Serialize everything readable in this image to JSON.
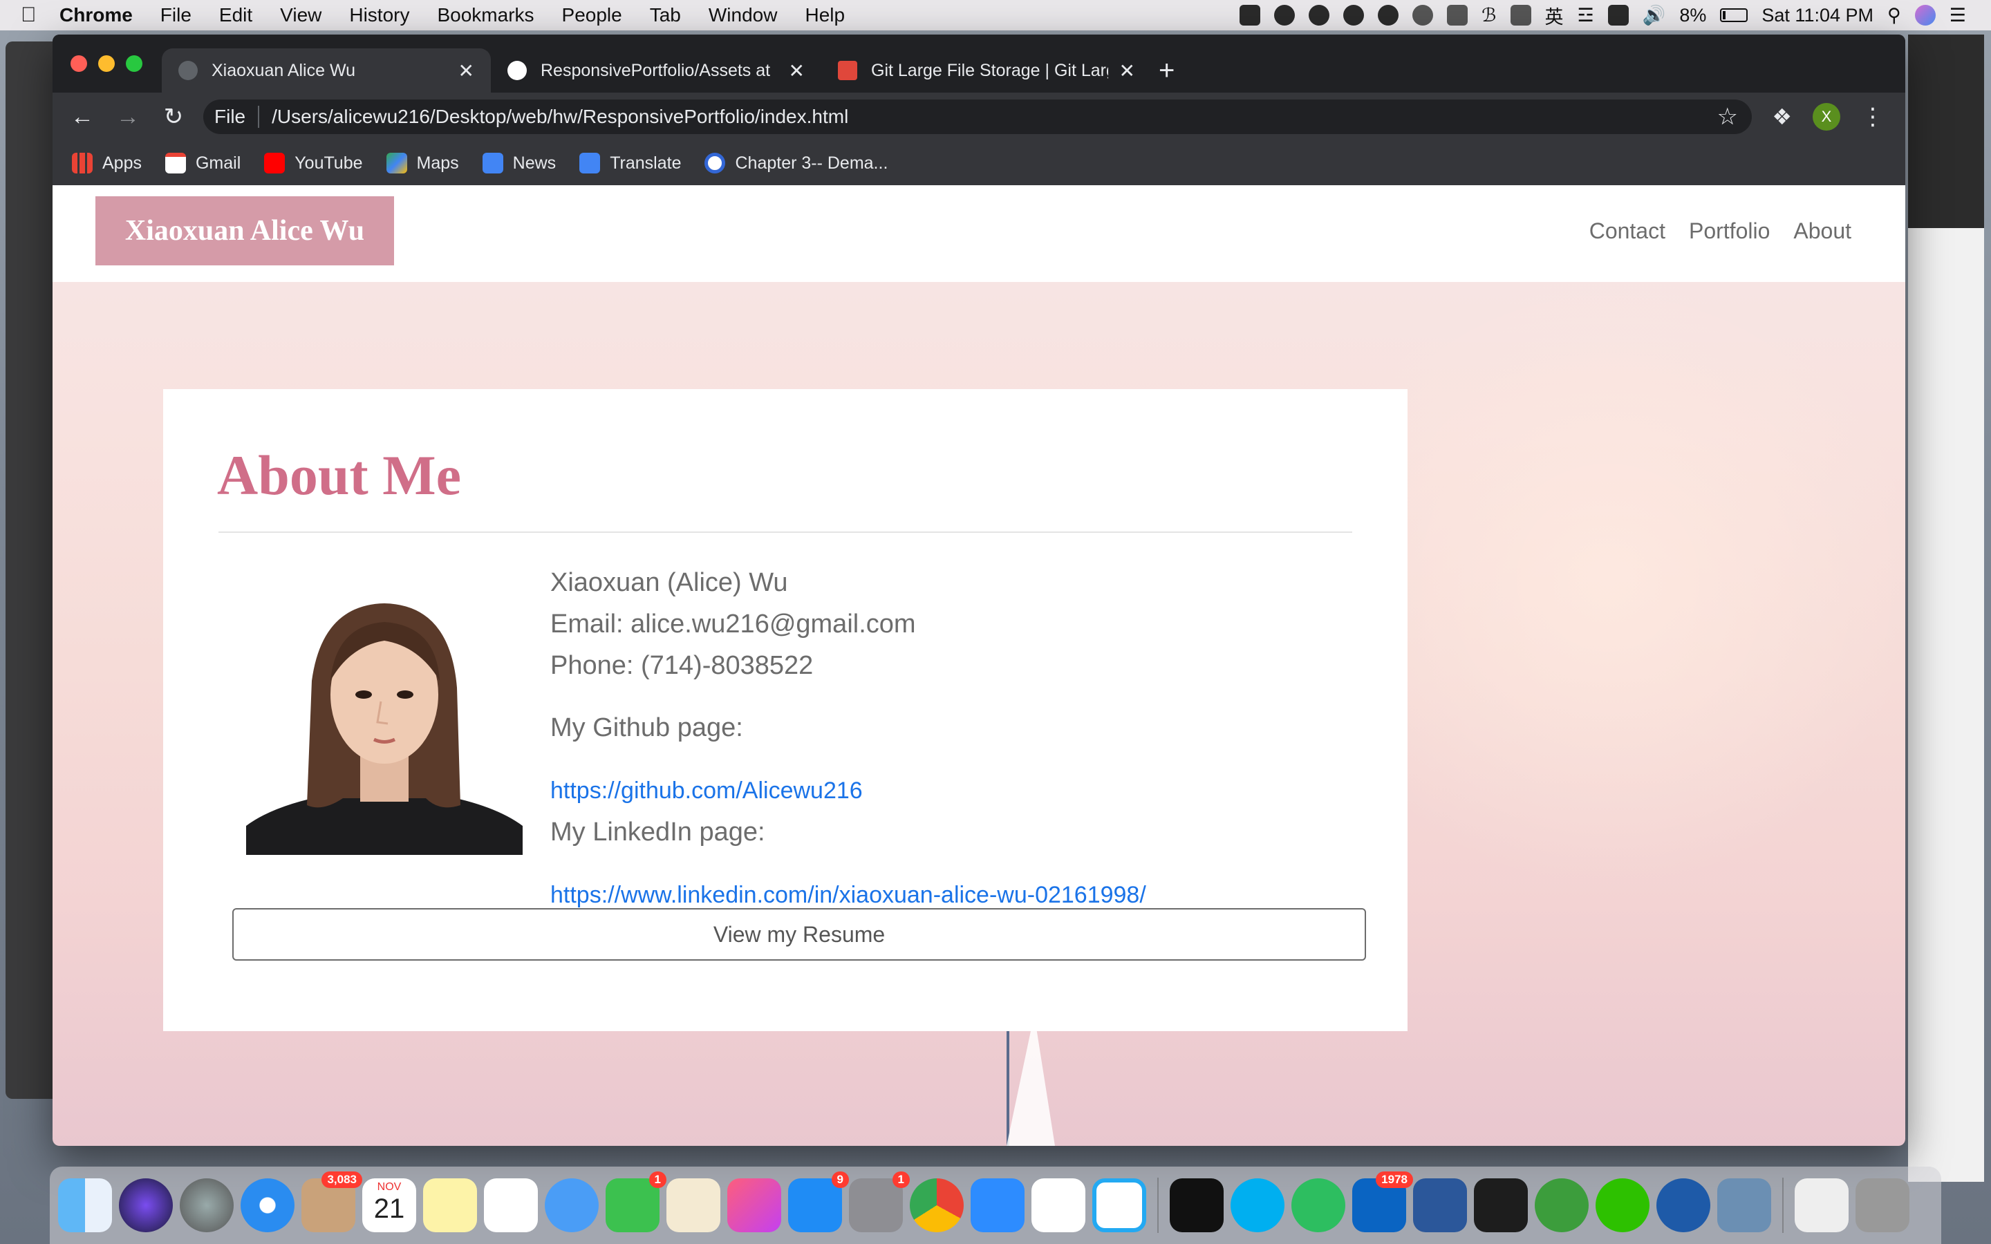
{
  "menubar": {
    "app": "Chrome",
    "items": [
      "File",
      "Edit",
      "View",
      "History",
      "Bookmarks",
      "People",
      "Tab",
      "Window",
      "Help"
    ],
    "battery": "8%",
    "clock": "Sat 11:04 PM",
    "input_method": "英"
  },
  "browser": {
    "tabs": [
      {
        "label": "Xiaoxuan Alice Wu",
        "active": true
      },
      {
        "label": "ResponsivePortfolio/Assets at",
        "active": false
      },
      {
        "label": "Git Large File Storage | Git Larg",
        "active": false
      }
    ],
    "omnibox": {
      "scheme": "File",
      "url": "/Users/alicewu216/Desktop/web/hw/ResponsivePortfolio/index.html"
    },
    "profile_initial": "X",
    "bookmarks": [
      "Apps",
      "Gmail",
      "YouTube",
      "Maps",
      "News",
      "Translate",
      "Chapter 3-- Dema..."
    ]
  },
  "site": {
    "brand": "Xiaoxuan Alice Wu",
    "nav": [
      "Contact",
      "Portfolio",
      "About"
    ],
    "heading": "About Me",
    "name": "Xiaoxuan (Alice) Wu",
    "email": "Email: alice.wu216@gmail.com",
    "phone": "Phone: (714)-8038522",
    "github_label": "My Github page:",
    "github_url": "https://github.com/Alicewu216",
    "linkedin_label": "My LinkedIn page:",
    "linkedin_url": "https://www.linkedin.com/in/xiaoxuan-alice-wu-02161998/",
    "resume_button": "View my Resume"
  },
  "dock": {
    "mail_badge": "3,083",
    "calendar_month": "NOV",
    "calendar_day": "21",
    "facetime_badge": "1",
    "appstore_badge": "9",
    "prefs_badge": "1",
    "outlook_badge": "1978"
  },
  "colors": {
    "brand_bg": "#d59ba8",
    "heading": "#d06e88",
    "link": "#1a73e8"
  }
}
